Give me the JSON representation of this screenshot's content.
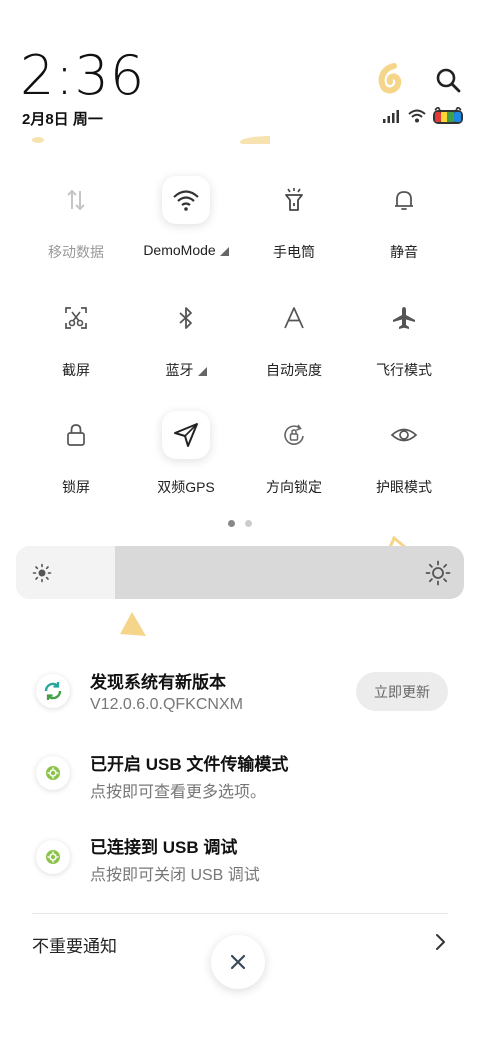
{
  "status": {
    "time": "2:36",
    "date": "2月8日 周一",
    "icons": [
      "signal-icon",
      "wifi-icon",
      "battery-icon"
    ]
  },
  "header": {
    "search_icon": "search-icon"
  },
  "toggles": [
    {
      "label": "移动数据",
      "icon": "mobile-data-icon",
      "active": false
    },
    {
      "label": "DemoMode",
      "icon": "wifi-icon",
      "active": true,
      "expandable": true
    },
    {
      "label": "手电筒",
      "icon": "flashlight-icon",
      "active": false
    },
    {
      "label": "静音",
      "icon": "bell-icon",
      "active": false
    },
    {
      "label": "截屏",
      "icon": "screenshot-icon",
      "active": false
    },
    {
      "label": "蓝牙",
      "icon": "bluetooth-icon",
      "active": false,
      "expandable": true
    },
    {
      "label": "自动亮度",
      "icon": "auto-brightness-icon",
      "active": false
    },
    {
      "label": "飞行模式",
      "icon": "airplane-icon",
      "active": false
    },
    {
      "label": "锁屏",
      "icon": "lock-icon",
      "active": false
    },
    {
      "label": "双频GPS",
      "icon": "gps-icon",
      "active": true
    },
    {
      "label": "方向锁定",
      "icon": "rotation-lock-icon",
      "active": false
    },
    {
      "label": "护眼模式",
      "icon": "eye-icon",
      "active": false
    }
  ],
  "pager": {
    "pages": 2,
    "current": 1
  },
  "brightness": {
    "level_percent": 22
  },
  "notifications": [
    {
      "title": "发现系统有新版本",
      "subtitle": "V12.0.6.0.QFKCNXM",
      "icon": "system-update-icon",
      "action": "立即更新"
    },
    {
      "title": "已开启 USB 文件传输模式",
      "subtitle": "点按即可查看更多选项。",
      "icon": "android-settings-icon"
    },
    {
      "title": "已连接到 USB 调试",
      "subtitle": "点按即可关闭 USB 调试",
      "icon": "android-settings-icon"
    }
  ],
  "footer": {
    "unimportant_label": "不重要通知",
    "close_icon": "close-icon"
  },
  "colors": {
    "accent_green": "#8BC34A",
    "deco_yellow": "#F5D58A"
  }
}
